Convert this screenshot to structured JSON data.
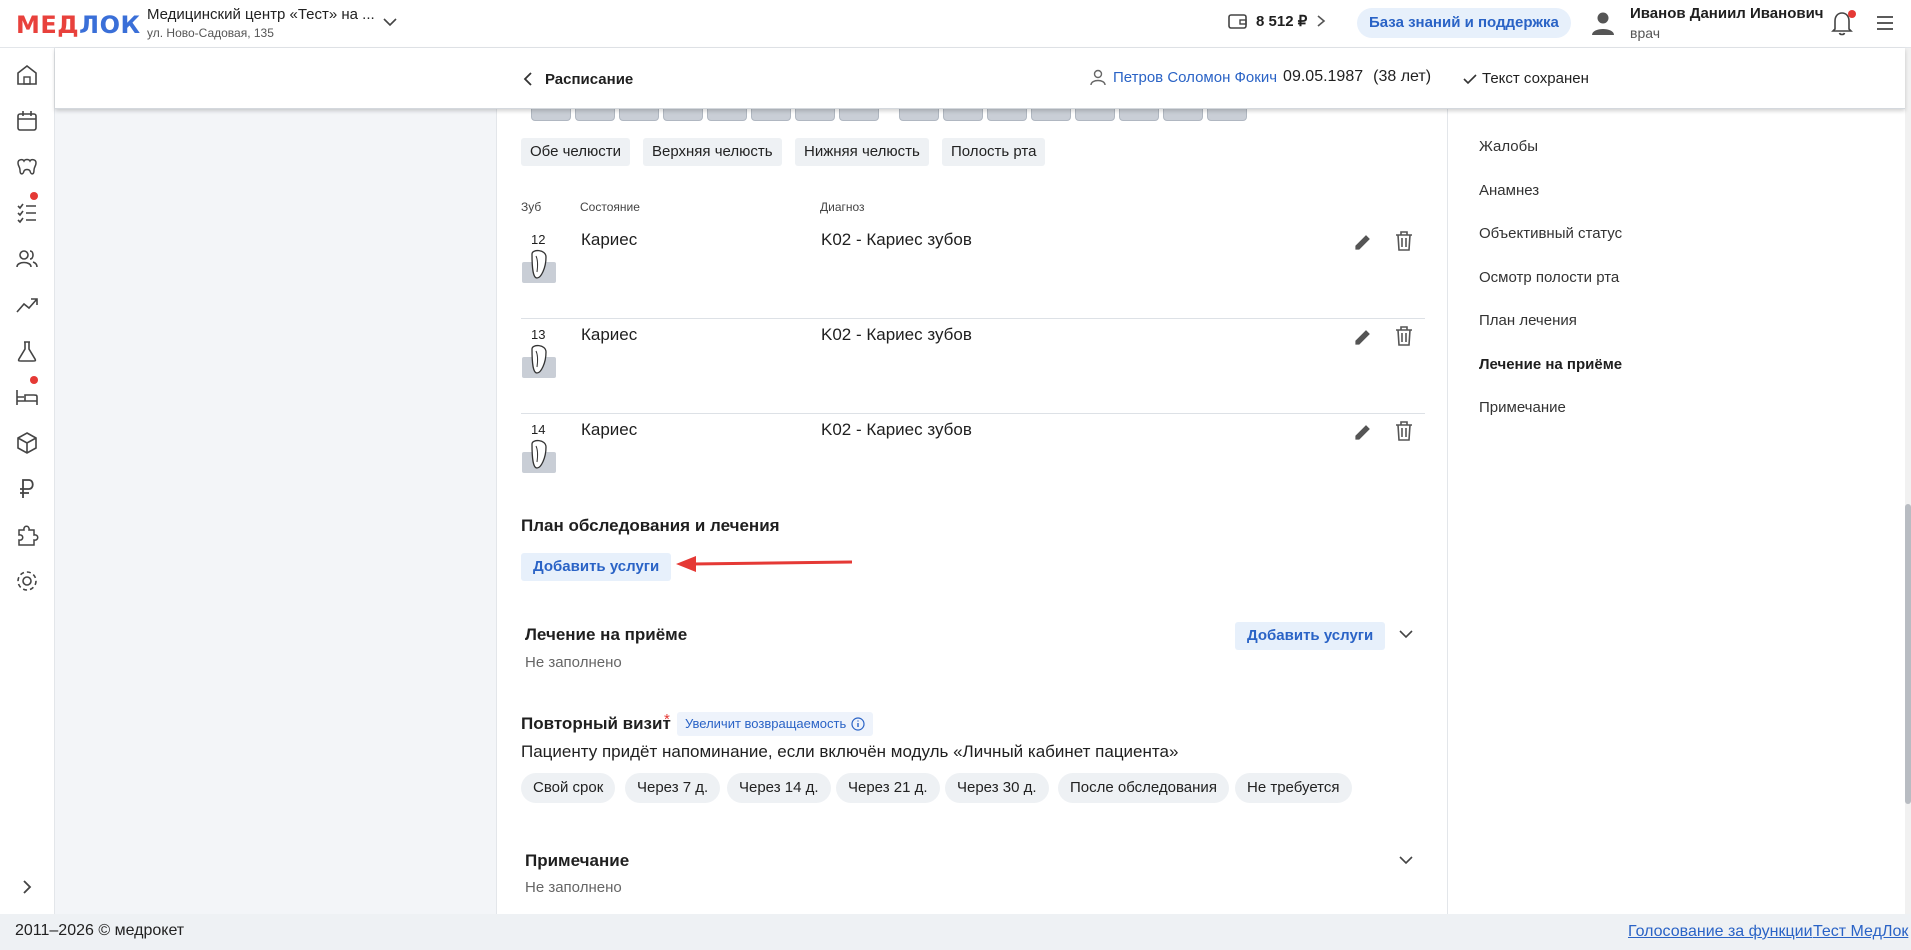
{
  "app": {
    "logo_part1": "МЕД",
    "logo_part2": "ЛОК",
    "clinic_name": "Медицинский центр «Тест» на ...",
    "clinic_address": "ул. Ново-Садовая, 135",
    "balance": "8 512 ₽",
    "knowledge_base": "База знаний и поддержка",
    "user_name": "Иванов Даниил Иванович",
    "user_role": "врач"
  },
  "header": {
    "title": "Расписание",
    "patient_name": "Петров Соломон Фокич",
    "patient_dob": "09.05.1987",
    "patient_age": "(38 лет)",
    "save_status": "Текст сохранен"
  },
  "right_nav": [
    "Жалобы",
    "Анамнез",
    "Объективный статус",
    "Осмотр полости рта",
    "План лечения",
    "Лечение на приёме",
    "Примечание"
  ],
  "right_nav_active": "Лечение на приёме",
  "jaw_buttons": [
    "Обе челюсти",
    "Верхняя челюсть",
    "Нижняя челюсть",
    "Полость рта"
  ],
  "table_headers": {
    "tooth": "Зуб",
    "state": "Состояние",
    "diagnosis": "Диагноз"
  },
  "diagnoses": [
    {
      "tooth": "12",
      "state": "Кариес",
      "diagnosis": "K02 - Кариес зубов"
    },
    {
      "tooth": "13",
      "state": "Кариес",
      "diagnosis": "K02 - Кариес зубов"
    },
    {
      "tooth": "14",
      "state": "Кариес",
      "diagnosis": "K02 - Кариес зубов"
    }
  ],
  "plan": {
    "title": "План обследования и лечения",
    "add_button": "Добавить услуги"
  },
  "treatment": {
    "title": "Лечение на приёме",
    "add_button": "Добавить услуги",
    "empty": "Не заполнено"
  },
  "revisit": {
    "title": "Повторный визит",
    "required_mark": "*",
    "badge": "Увеличит возвращаемость",
    "hint": "Пациенту придёт напоминание, если включён модуль «Личный кабинет пациента»",
    "options": [
      "Свой срок",
      "Через 7 д.",
      "Через 14 д.",
      "Через 21 д.",
      "Через 30 д.",
      "После обследования",
      "Не требуется"
    ]
  },
  "note": {
    "title": "Примечание",
    "empty": "Не заполнено"
  },
  "footer": {
    "copyright": "2011–2026 © медрокет",
    "link1": "Голосование за функции",
    "link2": "Тест МедЛок"
  },
  "colors": {
    "accent": "#2a63c6",
    "brand_red": "#e8413c",
    "annotation_arrow": "#e53935"
  }
}
